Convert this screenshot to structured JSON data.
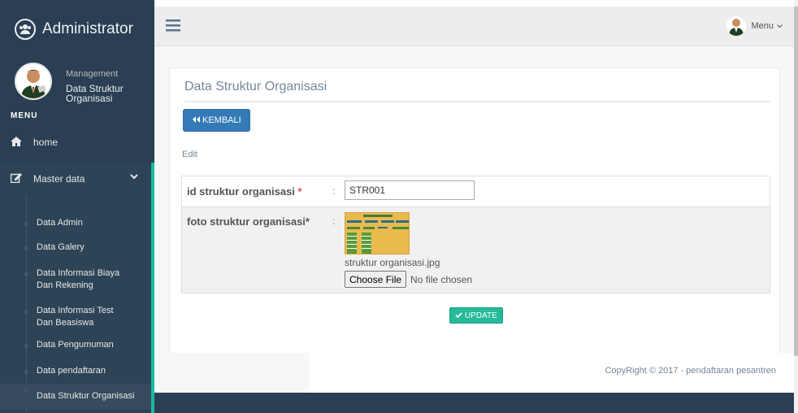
{
  "sidebar": {
    "brand_title": "Administrator",
    "profile_role": "Management",
    "profile_name": "Data Struktur Organisasi",
    "menu_heading": "MENU",
    "nav_home": "home",
    "nav_master": "Master data",
    "submenu": [
      "Data Admin",
      "Data Galery",
      "Data Informasi Biaya Dan Rekening",
      "Data Informasi Test Dan Beasiswa",
      "Data Pengumuman",
      "Data pendaftaran",
      "Data Struktur Organisasi"
    ],
    "active_submenu": "Data Struktur Organisasi"
  },
  "topnav": {
    "user_menu_label": "Menu"
  },
  "panel": {
    "title": "Data Struktur Organisasi",
    "back_button": "KEMBALI",
    "edit_label": "Edit",
    "fields": {
      "id_label": "id struktur organisasi",
      "id_required_mark": "*",
      "id_value": "STR001",
      "photo_label": "foto struktur organisasi*",
      "colon": ":",
      "photo_filename": "struktur organisasi.jpg",
      "choose_file_label": "Choose File",
      "no_file_text": "No file chosen"
    },
    "update_button": "UPDATE"
  },
  "footer": {
    "copyright": "CopyRight © 2017 - pendaftaran pesantren"
  },
  "colors": {
    "sidebar_bg": "#2a3f54",
    "accent": "#1ABB9C",
    "primary_button": "#337ab7",
    "success_button": "#26B99A"
  }
}
